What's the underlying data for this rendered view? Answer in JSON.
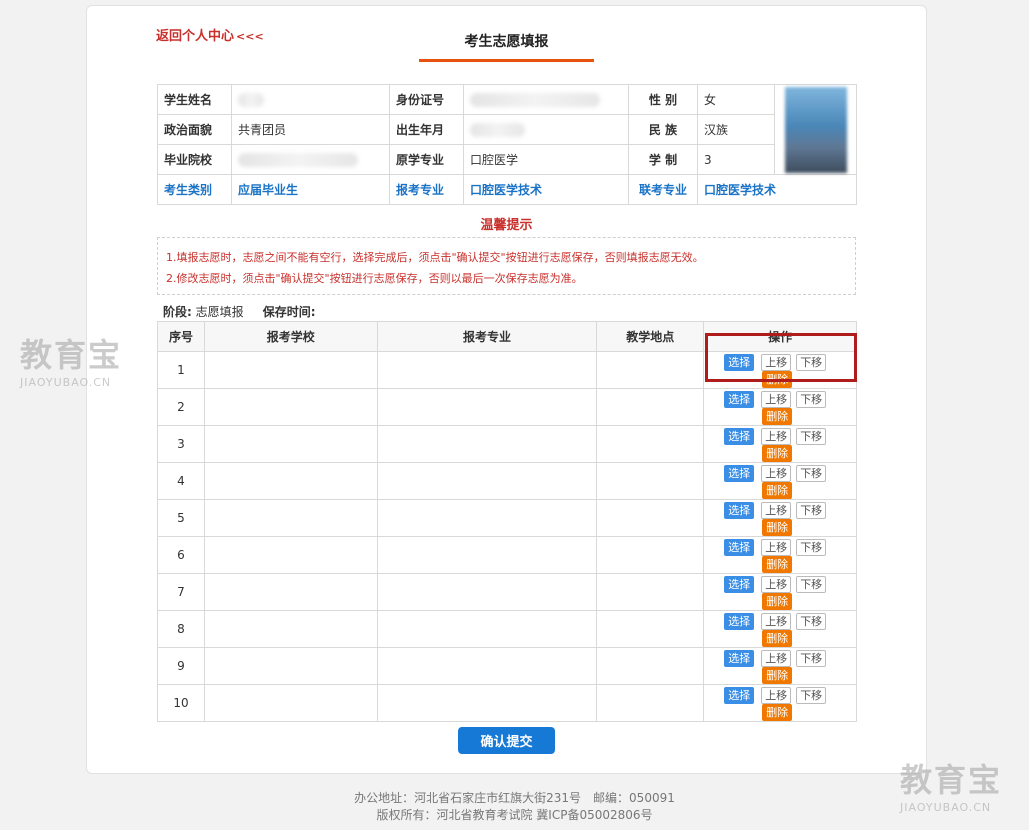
{
  "header": {
    "back_link": "返回个人中心",
    "back_arrows": "<<<",
    "title": "考生志愿填报"
  },
  "student": {
    "labels": {
      "name": "学生姓名",
      "id": "身份证号",
      "gender": "性 别",
      "political": "政治面貌",
      "birth": "出生年月",
      "ethnicity": "民 族",
      "school": "毕业院校",
      "orig_major": "原学专业",
      "years": "学 制",
      "category": "考生类别",
      "apply_major": "报考专业",
      "joint_major": "联考专业"
    },
    "values": {
      "gender": "女",
      "political": "共青团员",
      "ethnicity": "汉族",
      "orig_major": "口腔医学",
      "years": "3",
      "category": "应届毕业生",
      "apply_major": "口腔医学技术",
      "joint_major": "口腔医学技术"
    }
  },
  "tips": {
    "title": "温馨提示",
    "line1": "1.填报志愿时，志愿之间不能有空行，选择完成后，须点击\"确认提交\"按钮进行志愿保存，否则填报志愿无效。",
    "line2": "2.修改志愿时，须点击\"确认提交\"按钮进行志愿保存，否则以最后一次保存志愿为准。"
  },
  "stage": {
    "label": "阶段:",
    "value": "志愿填报",
    "save_label": "保存时间:"
  },
  "table": {
    "headers": [
      "序号",
      "报考学校",
      "报考专业",
      "教学地点",
      "操作"
    ],
    "rows": [
      "1",
      "2",
      "3",
      "4",
      "5",
      "6",
      "7",
      "8",
      "9",
      "10"
    ],
    "buttons": {
      "select": "选择",
      "up": "上移",
      "down": "下移",
      "delete": "删除"
    }
  },
  "submit_label": "确认提交",
  "footer": {
    "line1": "办公地址：河北省石家庄市红旗大街231号　邮编：050091",
    "line2": "版权所有：河北省教育考试院 冀ICP备05002806号"
  },
  "watermark": {
    "cn": "教育宝",
    "en": "JIAOYUBAO.CN"
  },
  "colors": {
    "accent": "#1779d6",
    "warning": "#c9302c",
    "orange": "#f07800"
  }
}
